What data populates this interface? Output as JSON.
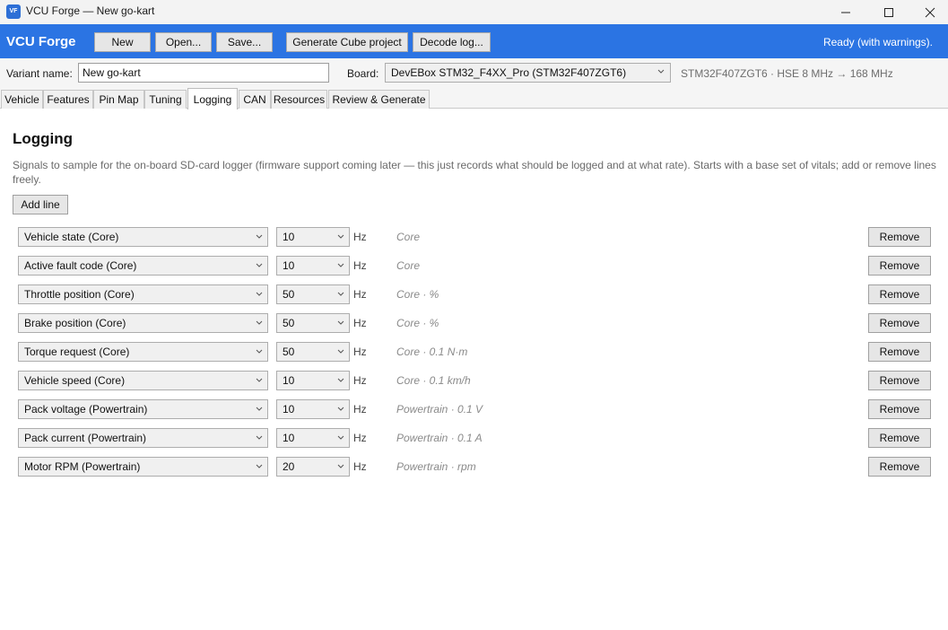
{
  "window": {
    "title": "VCU Forge — New go-kart",
    "icon_text": "VF"
  },
  "toolbar": {
    "brand": "VCU Forge",
    "buttons": [
      {
        "label": "New"
      },
      {
        "label": "Open..."
      },
      {
        "label": "Save..."
      },
      {
        "label": "Generate Cube project"
      },
      {
        "label": "Decode log..."
      }
    ],
    "status": "Ready (with warnings)."
  },
  "variant": {
    "label": "Variant name:",
    "value": "New go-kart",
    "board_label": "Board:",
    "board_value": "DevEBox STM32_F4XX_Pro (STM32F407ZGT6)",
    "board_info": "STM32F407ZGT6 · HSE 8 MHz → 168 MHz"
  },
  "tabs": [
    {
      "label": "Vehicle"
    },
    {
      "label": "Features"
    },
    {
      "label": "Pin Map"
    },
    {
      "label": "Tuning"
    },
    {
      "label": "Logging",
      "active": true
    },
    {
      "label": "CAN"
    },
    {
      "label": "Resources"
    },
    {
      "label": "Review & Generate"
    }
  ],
  "logging": {
    "title": "Logging",
    "description": "Signals to sample for the on-board SD-card logger (firmware support coming later — this just records what should be logged and at what rate). Starts with a base set of vitals; add or remove lines freely.",
    "add_label": "Add line",
    "unit_label": "Hz",
    "remove_label": "Remove",
    "rows": [
      {
        "signal": "Vehicle state (Core)",
        "rate": "10",
        "meta": "Core"
      },
      {
        "signal": "Active fault code (Core)",
        "rate": "10",
        "meta": "Core"
      },
      {
        "signal": "Throttle position (Core)",
        "rate": "50",
        "meta": "Core · %"
      },
      {
        "signal": "Brake position (Core)",
        "rate": "50",
        "meta": "Core · %"
      },
      {
        "signal": "Torque request (Core)",
        "rate": "50",
        "meta": "Core · 0.1 N·m"
      },
      {
        "signal": "Vehicle speed (Core)",
        "rate": "10",
        "meta": "Core · 0.1 km/h"
      },
      {
        "signal": "Pack voltage (Powertrain)",
        "rate": "10",
        "meta": "Powertrain · 0.1 V"
      },
      {
        "signal": "Pack current (Powertrain)",
        "rate": "10",
        "meta": "Powertrain · 0.1 A"
      },
      {
        "signal": "Motor RPM (Powertrain)",
        "rate": "20",
        "meta": "Powertrain · rpm"
      }
    ]
  }
}
